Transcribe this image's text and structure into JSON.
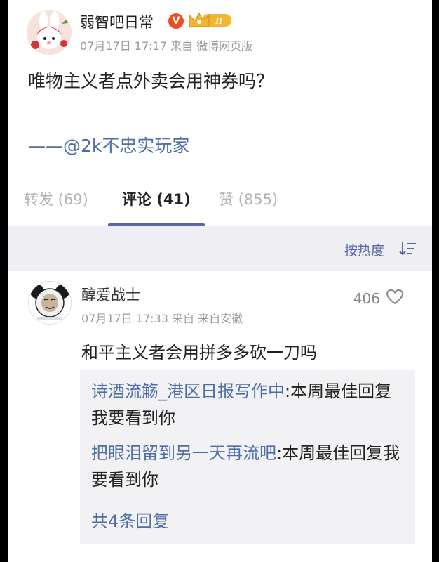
{
  "post": {
    "author": "弱智吧日常",
    "verified_badge": "V",
    "crown_badge": "II",
    "meta": "07月17日 17:17  来自 微博网页版",
    "text": "唯物主义者点外卖会用神券吗？",
    "signature": "——@2k不忠实玩家"
  },
  "tabs": [
    {
      "label": "转发 (69)"
    },
    {
      "label": "评论 (41)"
    },
    {
      "label": "赞 (855)"
    }
  ],
  "sort": {
    "label": "按热度"
  },
  "comment": {
    "author": "醇爱战士",
    "meta": "07月17日 17:33  来自 来自安徽",
    "likes": "406",
    "text": "和平主义者会用拼多多砍一刀吗",
    "replies": [
      {
        "name": "诗酒流觞_港区日报写作中",
        "text": ":本周最佳回复我要看到你"
      },
      {
        "name": "把眼泪留到另一天再流吧",
        "text": ":本周最佳回复我要看到你"
      }
    ],
    "more_replies": "共4条回复"
  },
  "colors": {
    "link": "#4e6ea6",
    "tab_accent": "#5b65a9",
    "sort_bg": "#eeeef3",
    "reply_bg": "#f2f2f4",
    "verified": "#e9501f",
    "crown": "#f2b632"
  }
}
